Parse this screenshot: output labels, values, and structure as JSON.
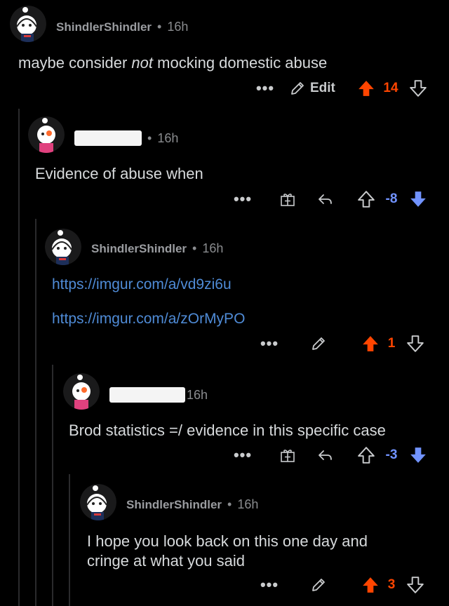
{
  "comments": [
    {
      "username": "ShindlerShindler",
      "separator": "•",
      "time": "16h",
      "body_pre": "maybe consider ",
      "body_em": "not",
      "body_post": " mocking domestic abuse",
      "actions": {
        "more": "•••",
        "edit_label": "Edit",
        "score": "14",
        "vote": "up"
      }
    },
    {
      "username": "",
      "separator": "•",
      "time": "16h",
      "body": "Evidence of abuse when",
      "actions": {
        "more": "•••",
        "score": "-8",
        "vote": "down"
      }
    },
    {
      "username": "ShindlerShindler",
      "separator": "•",
      "time": "16h",
      "links": [
        "https://imgur.com/a/vd9zi6u",
        "https://imgur.com/a/zOrMyPO"
      ],
      "actions": {
        "more": "•••",
        "score": "1",
        "vote": "up"
      }
    },
    {
      "username": "",
      "separator": "",
      "time": "16h",
      "body": "Brod statistics =/ evidence in this specific case",
      "actions": {
        "more": "•••",
        "score": "-3",
        "vote": "down"
      }
    },
    {
      "username": "ShindlerShindler",
      "separator": "•",
      "time": "16h",
      "body_line1": "I hope you look back on this one day and",
      "body_line2": "cringe at what you said",
      "actions": {
        "more": "•••",
        "score": "3",
        "vote": "up"
      }
    }
  ],
  "colors": {
    "background": "#000000",
    "upvote": "#ff4500",
    "downvote": "#7193ff",
    "link": "#4f8bd6",
    "thread_line": "#2a2a2c"
  },
  "icons": [
    "avatar-snoo-icon",
    "pencil-icon",
    "gift-award-icon",
    "reply-icon",
    "upvote-icon",
    "downvote-icon",
    "more-options-icon"
  ]
}
